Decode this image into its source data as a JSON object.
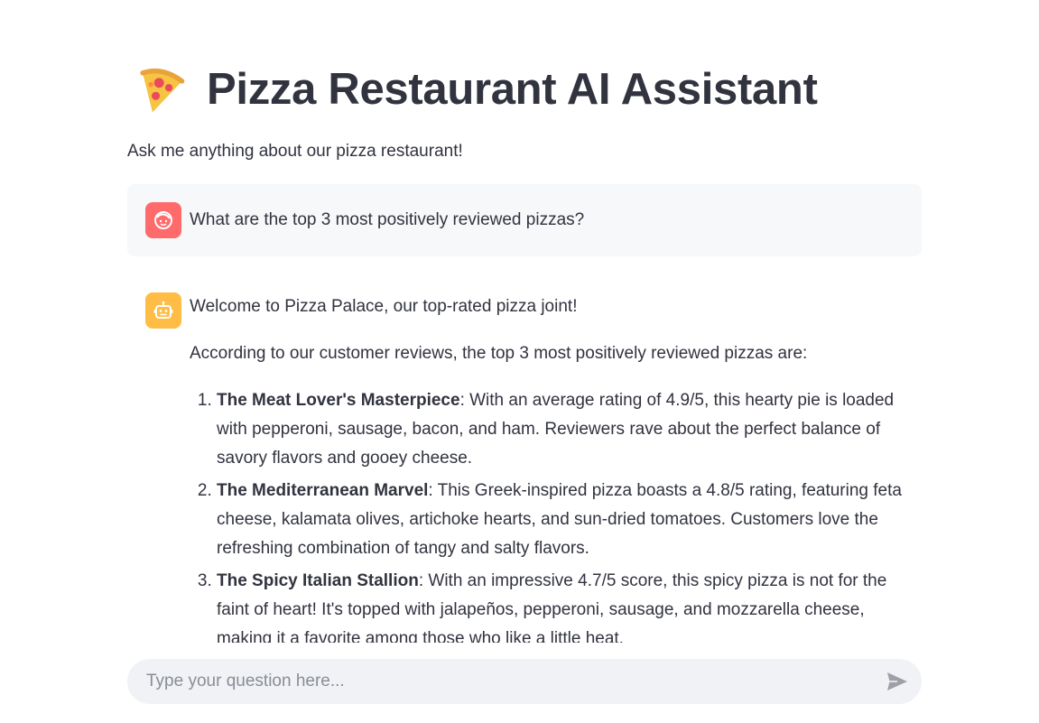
{
  "header": {
    "title": "Pizza Restaurant AI Assistant",
    "title_icon": "pizza-slice-icon",
    "subtitle": "Ask me anything about our pizza restaurant!"
  },
  "messages": [
    {
      "role": "user",
      "avatar_icon": "user-face-icon",
      "avatar_color": "#ff6b6b",
      "text": "What are the top 3 most positively reviewed pizzas?"
    },
    {
      "role": "assistant",
      "avatar_icon": "robot-icon",
      "avatar_color": "#ffbd45",
      "greeting": "Welcome to Pizza Palace, our top-rated pizza joint!",
      "intro": "According to our customer reviews, the top 3 most positively reviewed pizzas are:",
      "items": [
        {
          "name": "The Meat Lover's Masterpiece",
          "desc": ": With an average rating of 4.9/5, this hearty pie is loaded with pepperoni, sausage, bacon, and ham. Reviewers rave about the perfect balance of savory flavors and gooey cheese."
        },
        {
          "name": "The Mediterranean Marvel",
          "desc": ": This Greek-inspired pizza boasts a 4.8/5 rating, featuring feta cheese, kalamata olives, artichoke hearts, and sun-dried tomatoes. Customers love the refreshing combination of tangy and salty flavors."
        },
        {
          "name": "The Spicy Italian Stallion",
          "desc": ": With an impressive 4.7/5 score, this spicy pizza is not for the faint of heart! It's topped with jalapeños, pepperoni, sausage, and mozzarella cheese, making it a favorite among those who like a little heat."
        }
      ]
    }
  ],
  "chat_input": {
    "placeholder": "Type your question here...",
    "value": "",
    "send_icon": "send-arrow-icon"
  },
  "colors": {
    "text": "#31333f",
    "user_bubble_bg": "#f7f8fa",
    "input_bg": "#f0f2f6",
    "send_icon": "#9ea0a8"
  }
}
